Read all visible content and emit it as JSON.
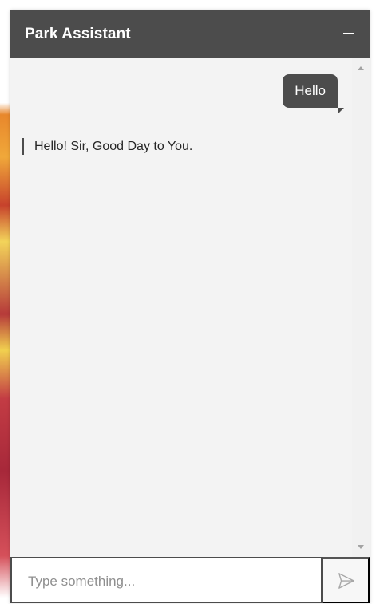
{
  "app": {
    "title": "Park Assistant"
  },
  "chat": {
    "messages": [
      {
        "sender": "user",
        "text": "Hello"
      },
      {
        "sender": "assistant",
        "text": "Hello! Sir, Good Day to You."
      }
    ]
  },
  "composer": {
    "placeholder": "Type something...",
    "value": ""
  },
  "icons": {
    "minimize": "minimize-icon",
    "send": "send-icon",
    "scroll_up": "scroll-up-icon",
    "scroll_down": "scroll-down-icon"
  },
  "colors": {
    "header": "#4c4c4c",
    "panel": "#f3f3f3",
    "bubble": "#4c4c4c",
    "text": "#262626"
  }
}
